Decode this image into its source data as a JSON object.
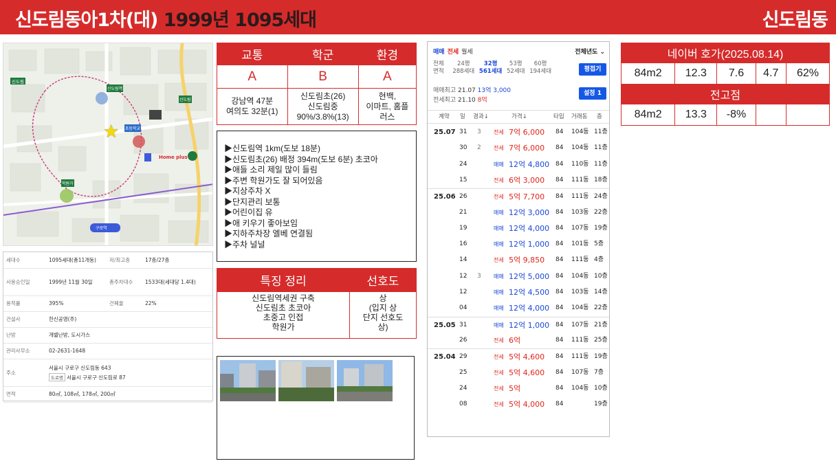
{
  "header": {
    "title_main": "신도림동아1차(대)",
    "title_sub": "1999년 1095세대",
    "region": "신도림동",
    "colors": {
      "bar": "#d62b2b",
      "sub_text": "#2b1a1a"
    }
  },
  "map": {
    "labels": [
      "신도림",
      "구로역",
      "Home plus",
      "학원가",
      "신도림역",
      "신도림",
      "초등학교"
    ],
    "markers": [
      {
        "kind": "star-icon"
      },
      {
        "kind": "bus-icon"
      }
    ]
  },
  "info": {
    "rows": [
      {
        "k1": "세대수",
        "v1": "1095세대(총11개동)",
        "k2": "저/최고층",
        "v2": "17층/27층"
      },
      {
        "k1": "사용승인일",
        "v1": "1999년 11월 30일",
        "k2": "총주차대수",
        "v2": "1533대(세대당 1.4대)"
      },
      {
        "k1": "용적률",
        "v1": "395%",
        "k2": "건폐율",
        "v2": "22%"
      },
      {
        "k1": "건설사",
        "v1": "한신공영(주)"
      },
      {
        "k1": "난방",
        "v1": "개별난방, 도시가스"
      },
      {
        "k1": "관리사무소",
        "v1": "02-2631-1648"
      },
      {
        "k1": "주소",
        "v1": "서울시 구로구 신도림동 643",
        "tag": "도로명",
        "v1b": "서울시 구로구 신도림로 87"
      },
      {
        "k1": "면적",
        "v1": "80㎡, 108㎡, 178㎡, 200㎡"
      }
    ]
  },
  "grades": {
    "headers": [
      "교통",
      "학군",
      "환경"
    ],
    "values": [
      "A",
      "B",
      "A"
    ],
    "details": [
      [
        "강남역 47분",
        "여의도 32분(1)"
      ],
      [
        "신도림초(26)",
        "신도림중",
        "90%/3.8%(13)"
      ],
      [
        "현백,",
        "이마트, 홈플",
        "러스"
      ]
    ]
  },
  "bullets": [
    "▶신도림역 1km(도보 18분)",
    "▶신도림초(26) 배정 394m(도보 6분) 초코아",
    "▶애들 소리 제일 많이 들림",
    "▶주변 학원가도 잘 되어있음",
    "▶지상주차 X",
    "▶단지관리 보통",
    "▶어린이집 유",
    "▶애 키우기 좋아보임",
    "▶지하주차장 엘베 연결됨",
    "▶주차 널널"
  ],
  "features": {
    "h1": "특징 정리",
    "h2": "선호도",
    "left": [
      "신도림역세권 구축",
      "신도림초 초코아",
      "초중고 인접",
      "학원가"
    ],
    "right": [
      "상",
      "(입지 상",
      "단지 선호도",
      "상)"
    ]
  },
  "transactions": {
    "tabs": [
      "매매",
      "전세",
      "월세"
    ],
    "year_filter": "전체년도",
    "sizes": [
      {
        "a": "전체",
        "b": "면적"
      },
      {
        "a": "24평",
        "b": "288세대"
      },
      {
        "a": "32평",
        "b": "561세대"
      },
      {
        "a": "53평",
        "b": "52세대"
      },
      {
        "a": "60평",
        "b": "194세대"
      }
    ],
    "btn_fold": "평접기",
    "btn_set": "설정 1",
    "peak_maemae_label": "매매최고",
    "peak_maemae_date": "21.07",
    "peak_maemae_val": "13억 3,000",
    "peak_jeonse_label": "전세최고",
    "peak_jeonse_date": "21.10",
    "peak_jeonse_val": "8억",
    "cols": [
      "계약",
      "일",
      "경과↓",
      "가격↓",
      "타입",
      "거래동",
      "층"
    ],
    "rows": [
      {
        "mon": "25.07",
        "day": "31",
        "lap": "3",
        "kind": "전세",
        "amt": "7억 6,000",
        "tp": "84",
        "dong": "104동",
        "fl": "11층"
      },
      {
        "mon": "",
        "day": "30",
        "lap": "2",
        "kind": "전세",
        "amt": "7억 6,000",
        "tp": "84",
        "dong": "104동",
        "fl": "11층"
      },
      {
        "mon": "",
        "day": "24",
        "lap": "",
        "kind": "매매",
        "amt": "12억 4,800",
        "tp": "84",
        "dong": "110동",
        "fl": "11층"
      },
      {
        "mon": "",
        "day": "15",
        "lap": "",
        "kind": "전세",
        "amt": "6억 3,000",
        "tp": "84",
        "dong": "111동",
        "fl": "18층"
      },
      {
        "mon": "25.06",
        "day": "26",
        "lap": "",
        "kind": "전세",
        "amt": "5억 7,700",
        "tp": "84",
        "dong": "111동",
        "fl": "24층"
      },
      {
        "mon": "",
        "day": "21",
        "lap": "",
        "kind": "매매",
        "amt": "12억 3,000",
        "tp": "84",
        "dong": "103동",
        "fl": "22층"
      },
      {
        "mon": "",
        "day": "19",
        "lap": "",
        "kind": "매매",
        "amt": "12억 4,000",
        "tp": "84",
        "dong": "107동",
        "fl": "19층"
      },
      {
        "mon": "",
        "day": "16",
        "lap": "",
        "kind": "매매",
        "amt": "12억 1,000",
        "tp": "84",
        "dong": "101동",
        "fl": "5층"
      },
      {
        "mon": "",
        "day": "14",
        "lap": "",
        "kind": "전세",
        "amt": "5억 9,850",
        "tp": "84",
        "dong": "111동",
        "fl": "4층"
      },
      {
        "mon": "",
        "day": "12",
        "lap": "3",
        "kind": "매매",
        "amt": "12억 5,000",
        "tp": "84",
        "dong": "104동",
        "fl": "10층"
      },
      {
        "mon": "",
        "day": "12",
        "lap": "",
        "kind": "매매",
        "amt": "12억 4,500",
        "tp": "84",
        "dong": "103동",
        "fl": "14층"
      },
      {
        "mon": "",
        "day": "04",
        "lap": "",
        "kind": "매매",
        "amt": "12억 4,000",
        "tp": "84",
        "dong": "104동",
        "fl": "22층"
      },
      {
        "mon": "25.05",
        "day": "31",
        "lap": "",
        "kind": "매매",
        "amt": "12억 1,000",
        "tp": "84",
        "dong": "107동",
        "fl": "21층"
      },
      {
        "mon": "",
        "day": "26",
        "lap": "",
        "kind": "전세",
        "amt": "6억",
        "tp": "84",
        "dong": "111동",
        "fl": "25층"
      },
      {
        "mon": "25.04",
        "day": "29",
        "lap": "",
        "kind": "전세",
        "amt": "5억 4,600",
        "tp": "84",
        "dong": "111동",
        "fl": "19층"
      },
      {
        "mon": "",
        "day": "25",
        "lap": "",
        "kind": "전세",
        "amt": "5억 4,600",
        "tp": "84",
        "dong": "107동",
        "fl": "7층"
      },
      {
        "mon": "",
        "day": "24",
        "lap": "",
        "kind": "전세",
        "amt": "5억",
        "tp": "84",
        "dong": "104동",
        "fl": "10층"
      },
      {
        "mon": "",
        "day": "08",
        "lap": "",
        "kind": "전세",
        "amt": "5억 4,000",
        "tp": "84",
        "dong": "",
        "fl": "19층"
      }
    ]
  },
  "naver": {
    "title": "네이버 호가(2025.08.14)",
    "row": [
      "84m2",
      "12.3",
      "7.6",
      "4.7",
      "62%"
    ],
    "low_title": "전고점",
    "low_row": [
      "84m2",
      "13.3",
      "-8%",
      "",
      ""
    ]
  }
}
